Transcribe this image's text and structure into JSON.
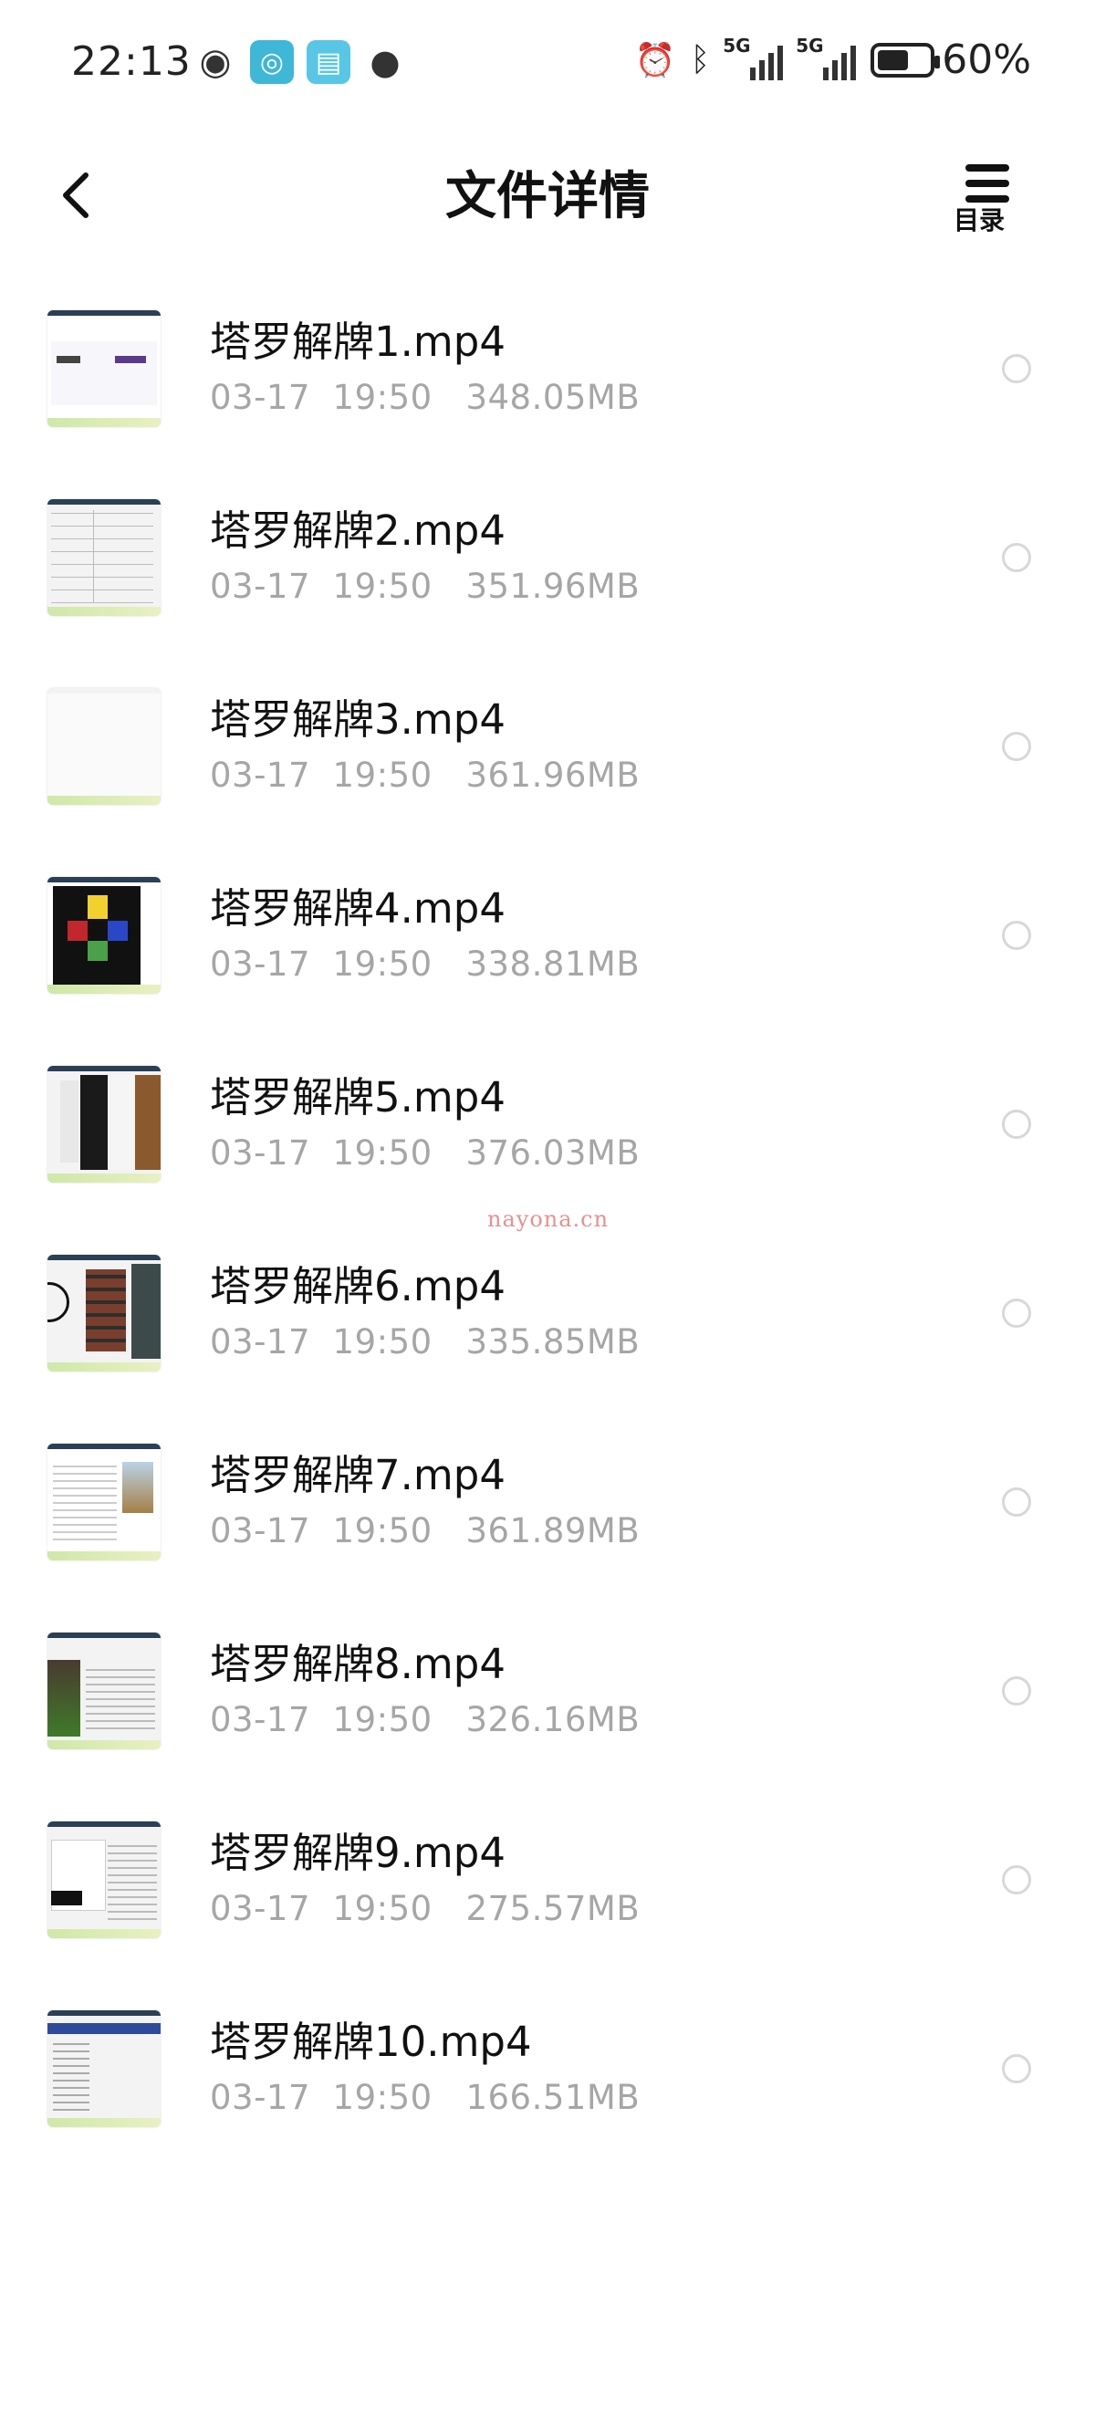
{
  "status_bar": {
    "time": "22:13",
    "left_icons": [
      "eye-icon",
      "app-swirl-icon",
      "book-app-icon",
      "wechat-icon"
    ],
    "right_icons": [
      "alarm-icon",
      "bluetooth-icon",
      "signal-5g-1-icon",
      "signal-5g-2-icon",
      "battery-icon"
    ],
    "signal_label_1": "5G",
    "signal_label_2": "5G",
    "battery_percent": "60%",
    "battery_level": 0.6
  },
  "header": {
    "title": "文件详情",
    "toc_label": "目录"
  },
  "files": [
    {
      "name": "塔罗解牌1.mp4",
      "meta": "03-17  19:50   348.05MB"
    },
    {
      "name": "塔罗解牌2.mp4",
      "meta": "03-17  19:50   351.96MB"
    },
    {
      "name": "塔罗解牌3.mp4",
      "meta": "03-17  19:50   361.96MB"
    },
    {
      "name": "塔罗解牌4.mp4",
      "meta": "03-17  19:50   338.81MB"
    },
    {
      "name": "塔罗解牌5.mp4",
      "meta": "03-17  19:50   376.03MB"
    },
    {
      "name": "塔罗解牌6.mp4",
      "meta": "03-17  19:50   335.85MB"
    },
    {
      "name": "塔罗解牌7.mp4",
      "meta": "03-17  19:50   361.89MB"
    },
    {
      "name": "塔罗解牌8.mp4",
      "meta": "03-17  19:50   326.16MB"
    },
    {
      "name": "塔罗解牌9.mp4",
      "meta": "03-17  19:50   275.57MB"
    },
    {
      "name": "塔罗解牌10.mp4",
      "meta": "03-17  19:50   166.51MB"
    }
  ],
  "watermark": "nayona.cn",
  "colors": {
    "meta_text": "#a6a6a6",
    "radio_border": "#d8d8d8",
    "watermark": "#e89090"
  }
}
